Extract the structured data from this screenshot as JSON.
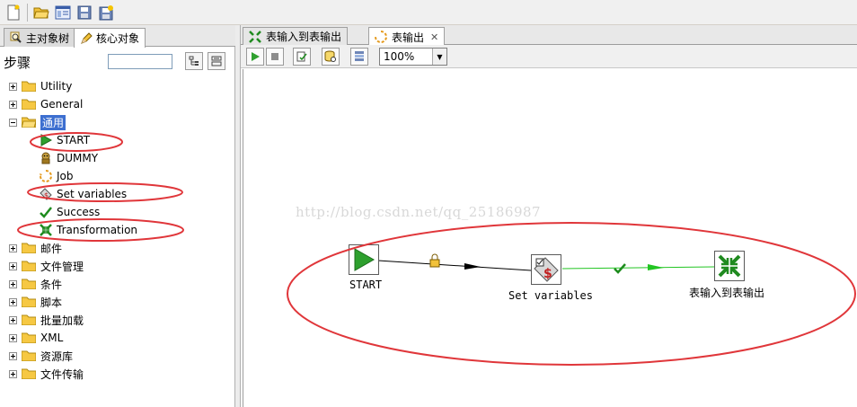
{
  "toolbar": {
    "icons": [
      "new-file-icon",
      "open-folder-icon",
      "explore-repository-icon",
      "save-icon",
      "save-as-icon"
    ]
  },
  "left_panel": {
    "tabs": [
      {
        "label": "主对象树",
        "icon": "magnifier-icon"
      },
      {
        "label": "核心对象",
        "icon": "pencil-icon"
      }
    ],
    "steps_label": "步骤",
    "search_value": "",
    "tree": [
      {
        "label": "Utility",
        "expanded": false
      },
      {
        "label": "General",
        "expanded": false
      },
      {
        "label": "通用",
        "expanded": true,
        "selected": true
      },
      {
        "label": "START",
        "child": true,
        "icon": "start-arrow-icon"
      },
      {
        "label": "DUMMY",
        "child": true,
        "icon": "dummy-icon"
      },
      {
        "label": "Job",
        "child": true,
        "icon": "job-icon"
      },
      {
        "label": "Set variables",
        "child": true,
        "icon": "set-variables-icon"
      },
      {
        "label": "Success",
        "child": true,
        "icon": "success-check-icon"
      },
      {
        "label": "Transformation",
        "child": true,
        "icon": "transformation-icon"
      },
      {
        "label": "邮件",
        "expanded": false
      },
      {
        "label": "文件管理",
        "expanded": false
      },
      {
        "label": "条件",
        "expanded": false
      },
      {
        "label": "脚本",
        "expanded": false
      },
      {
        "label": "批量加载",
        "expanded": false
      },
      {
        "label": "XML",
        "expanded": false
      },
      {
        "label": "资源库",
        "expanded": false
      },
      {
        "label": "文件传输",
        "expanded": false
      }
    ]
  },
  "editor": {
    "tabs": [
      {
        "label": "表输入到表输出",
        "active": false
      },
      {
        "label": "表输出",
        "active": true
      }
    ],
    "zoom": "100%",
    "watermark": "http://blog.csdn.net/qq_25186987",
    "nodes": [
      {
        "label": "START"
      },
      {
        "label": "Set variables"
      },
      {
        "label": "表输入到表输出"
      }
    ]
  },
  "colors": {
    "annotation_red": "#e0363a",
    "hop_green": "#22c522",
    "start_green": "#2ea02e",
    "selection_blue": "#3d6fd0"
  }
}
